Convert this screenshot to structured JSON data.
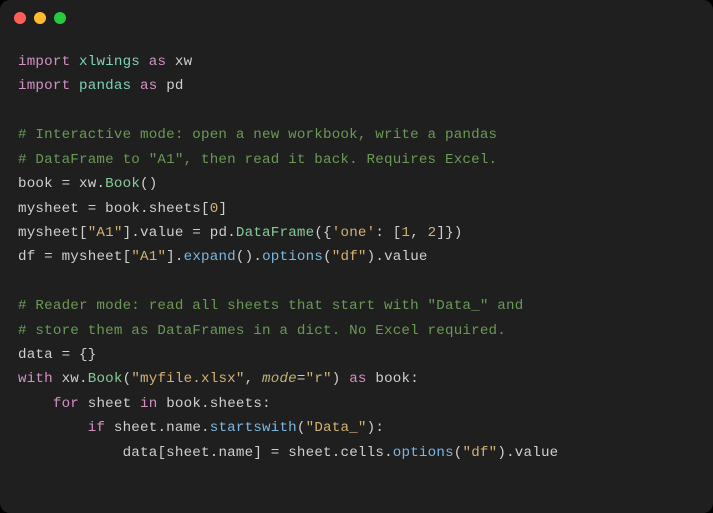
{
  "code": {
    "l1": {
      "kw_import": "import",
      "mod": "xlwings",
      "kw_as": "as",
      "alias": "xw"
    },
    "l2": {
      "kw_import": "import",
      "mod": "pandas",
      "kw_as": "as",
      "alias": "pd"
    },
    "l4": "# Interactive mode: open a new workbook, write a pandas",
    "l5": "# DataFrame to \"A1\", then read it back. Requires Excel.",
    "l6": {
      "lhs": "book",
      "eq": " = ",
      "obj": "xw",
      "dot": ".",
      "cls": "Book",
      "call": "()"
    },
    "l7": {
      "lhs": "mysheet",
      "eq": " = ",
      "obj": "book",
      "dot": ".",
      "attr": "sheets",
      "lb": "[",
      "num": "0",
      "rb": "]"
    },
    "l8": {
      "obj": "mysheet",
      "lb": "[",
      "str1": "\"A1\"",
      "rb": "]",
      "dot": ".",
      "attr": "value",
      "eq": " = ",
      "obj2": "pd",
      "dot2": ".",
      "cls": "DataFrame",
      "lp": "({",
      "str2": "'one'",
      "colon": ": [",
      "n1": "1",
      "comma": ", ",
      "n2": "2",
      "rp": "]})"
    },
    "l9": {
      "lhs": "df",
      "eq": " = ",
      "obj": "mysheet",
      "lb": "[",
      "str": "\"A1\"",
      "rb": "].",
      "m1": "expand",
      "p1": "().",
      "m2": "options",
      "lp2": "(",
      "str2": "\"df\"",
      "rp2": ").",
      "attr": "value"
    },
    "l11": "# Reader mode: read all sheets that start with \"Data_\" and",
    "l12": "# store them as DataFrames in a dict. No Excel required.",
    "l13": {
      "lhs": "data",
      "eq": " = ",
      "val": "{}"
    },
    "l14": {
      "kw_with": "with",
      "obj": "xw",
      "dot": ".",
      "cls": "Book",
      "lp": "(",
      "str": "\"myfile.xlsx\"",
      "comma": ", ",
      "argn": "mode",
      "argeq": "=",
      "str2": "\"r\"",
      "rp": ")",
      "kw_as": "as",
      "alias": "book",
      "colon": ":"
    },
    "l15": {
      "kw_for": "for",
      "var": "sheet",
      "kw_in": "in",
      "obj": "book",
      "dot": ".",
      "attr": "sheets",
      "colon": ":"
    },
    "l16": {
      "kw_if": "if",
      "obj": "sheet",
      "dot": ".",
      "attr": "name",
      "dot2": ".",
      "m": "startswith",
      "lp": "(",
      "str": "\"Data_\"",
      "rp": "):"
    },
    "l17": {
      "obj": "data",
      "lb": "[",
      "obj2": "sheet",
      "dot": ".",
      "attr2": "name",
      "rb": "]",
      "eq": " = ",
      "obj3": "sheet",
      "dot2": ".",
      "attr3": "cells",
      "dot3": ".",
      "m": "options",
      "lp": "(",
      "str": "\"df\"",
      "rp": ").",
      "attr4": "value"
    }
  }
}
